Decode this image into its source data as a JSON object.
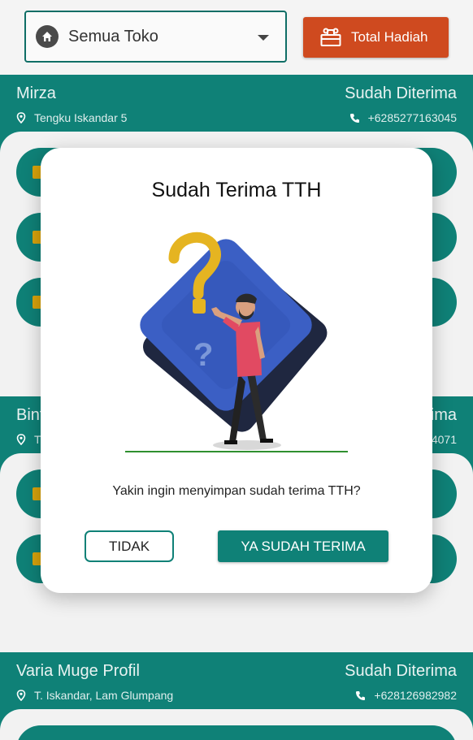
{
  "filter": {
    "store_select_value": "Semua Toko",
    "gift_button_label": "Total Hadiah"
  },
  "stores": [
    {
      "name": "Mirza",
      "status": "Sudah Diterima",
      "address": "Tengku Iskandar 5",
      "phone": "+6285277163045"
    },
    {
      "name": "Bint",
      "status": "rima",
      "address": "T",
      "phone": "4071"
    },
    {
      "name": "Varia Muge Profil",
      "status": "Sudah Diterima",
      "address": "T. Iskandar, Lam Glumpang",
      "phone": "+628126982982"
    }
  ],
  "dialog": {
    "title": "Sudah Terima TTH",
    "message": "Yakin ingin menyimpan sudah terima TTH?",
    "cancel_label": "TIDAK",
    "confirm_label": "YA SUDAH TERIMA"
  },
  "colors": {
    "primary": "#0f8177",
    "accent": "#cf4a1f",
    "gold": "#e5b421"
  }
}
